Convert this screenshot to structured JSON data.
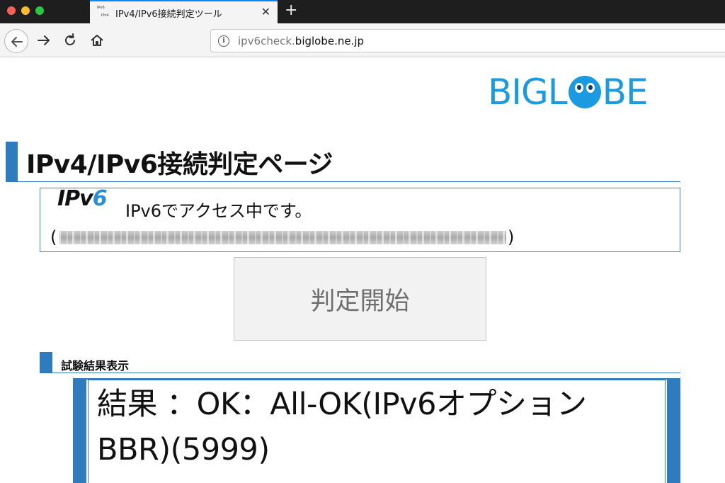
{
  "browser": {
    "tab": {
      "favicon_text_top": "IPv6",
      "favicon_text_bottom": "IPv4",
      "title": "IPv4/IPv6接続判定ツール",
      "close_glyph": "✕"
    },
    "new_tab_glyph": "+",
    "url_host_prefix": "ipv6check.",
    "url_host_domain": "biglobe.ne.jp"
  },
  "page": {
    "logo": {
      "left_text": "BIGL",
      "right_text": "BE"
    },
    "heading": "IPv4/IPv6接続判定ページ",
    "status": {
      "ipv6_logo_prefix": "IPv",
      "ipv6_logo_suffix": "6",
      "message": "IPv6でアクセス中です。",
      "open_paren": "(",
      "close_paren": ")"
    },
    "start_button_label": "判定開始",
    "results_heading": "試験結果表示",
    "result_text": "結果 ：OK：All-OK(IPv6オプション BBR)(5999)"
  },
  "colors": {
    "accent_blue": "#2e7bbd",
    "logo_blue": "#1a9ae0"
  },
  "icons": [
    "back-arrow-icon",
    "forward-arrow-icon",
    "reload-icon",
    "home-icon",
    "info-icon",
    "close-icon",
    "plus-icon"
  ]
}
